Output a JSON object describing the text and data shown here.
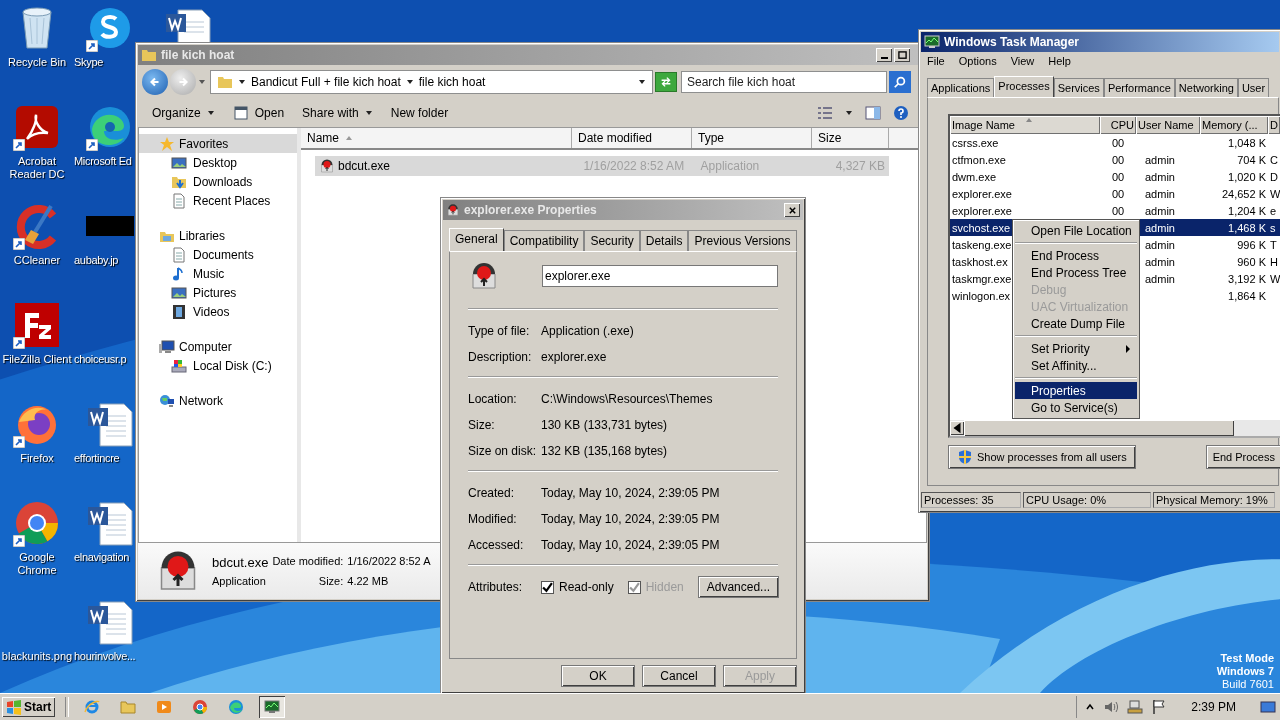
{
  "desktop_icons": [
    {
      "label": "Recycle Bin",
      "kind": "recycle",
      "shortcut": false
    },
    {
      "label": "Skype",
      "kind": "skype",
      "shortcut": true
    },
    {
      "label": "Acrobat Reader DC",
      "kind": "acrobat",
      "shortcut": true
    },
    {
      "label": "Microsoft Ed",
      "kind": "edge",
      "shortcut": true
    },
    {
      "label": "CCleaner",
      "kind": "ccleaner",
      "shortcut": true
    },
    {
      "label": "aubaby.jp",
      "kind": "black-image",
      "shortcut": false
    },
    {
      "label": "FileZilla Client",
      "kind": "filezilla",
      "shortcut": true
    },
    {
      "label": "choiceusr.p",
      "kind": "blank",
      "shortcut": false
    },
    {
      "label": "Firefox",
      "kind": "firefox",
      "shortcut": true
    },
    {
      "label": "effortincre",
      "kind": "word",
      "shortcut": false
    },
    {
      "label": "Google Chrome",
      "kind": "chrome",
      "shortcut": true
    },
    {
      "label": "elnavigation",
      "kind": "word",
      "shortcut": false
    },
    {
      "label": "blackunits.png",
      "kind": "blank",
      "shortcut": false
    },
    {
      "label": "hourinvolve...",
      "kind": "word",
      "shortcut": false
    }
  ],
  "explorer": {
    "title": "file kich hoat",
    "breadcrumb": [
      "Bandicut Full + file kich hoat",
      "file kich hoat"
    ],
    "search": {
      "placeholder": "Search file kich hoat"
    },
    "toolbar": [
      {
        "label": "Organize",
        "kind": "menu"
      },
      {
        "label": "Open",
        "kind": "open"
      },
      {
        "label": "Share with",
        "kind": "menu"
      },
      {
        "label": "New folder",
        "kind": "plain"
      }
    ],
    "nav": [
      {
        "label": "Favorites",
        "kind": "star",
        "selected": true,
        "children": [
          {
            "label": "Desktop",
            "kind": "desktop"
          },
          {
            "label": "Downloads",
            "kind": "downloads"
          },
          {
            "label": "Recent Places",
            "kind": "recent"
          }
        ]
      },
      {
        "label": "Libraries",
        "kind": "libraries",
        "selected": false,
        "children": [
          {
            "label": "Documents",
            "kind": "documents"
          },
          {
            "label": "Music",
            "kind": "music"
          },
          {
            "label": "Pictures",
            "kind": "pictures"
          },
          {
            "label": "Videos",
            "kind": "videos"
          }
        ]
      },
      {
        "label": "Computer",
        "kind": "computer",
        "selected": false,
        "children": [
          {
            "label": "Local Disk (C:)",
            "kind": "disk"
          }
        ]
      },
      {
        "label": "Network",
        "kind": "network",
        "selected": false
      }
    ],
    "columns": [
      {
        "label": "Name",
        "sorted": true
      },
      {
        "label": "Date modified",
        "sorted": false
      },
      {
        "label": "Type",
        "sorted": false
      },
      {
        "label": "Size",
        "sorted": false
      }
    ],
    "files": [
      {
        "name": "bdcut.exe",
        "date": "1/16/2022 8:52 AM",
        "type": "Application",
        "size": "4,327 KB",
        "selected": true
      }
    ],
    "details": {
      "name": "bdcut.exe",
      "type": "Application",
      "date_label": "Date modified:",
      "date": "1/16/2022 8:52 A",
      "size_label": "Size:",
      "size": "4.22 MB"
    }
  },
  "properties": {
    "title": "explorer.exe Properties",
    "tabs": [
      {
        "label": "General",
        "selected": true
      },
      {
        "label": "Compatibility",
        "selected": false
      },
      {
        "label": "Security",
        "selected": false
      },
      {
        "label": "Details",
        "selected": false
      },
      {
        "label": "Previous Versions",
        "selected": false
      }
    ],
    "name": "explorer.exe",
    "groups": [
      [
        {
          "label": "Type of file:",
          "value": "Application (.exe)"
        },
        {
          "label": "Description:",
          "value": "explorer.exe"
        }
      ],
      [
        {
          "label": "Location:",
          "value": "C:\\Windows\\Resources\\Themes"
        },
        {
          "label": "Size:",
          "value": "130 KB (133,731 bytes)"
        },
        {
          "label": "Size on disk:",
          "value": "132 KB (135,168 bytes)"
        }
      ],
      [
        {
          "label": "Created:",
          "value": "Today, May 10, 2024, 2:39:05 PM"
        },
        {
          "label": "Modified:",
          "value": "Today, May 10, 2024, 2:39:05 PM"
        },
        {
          "label": "Accessed:",
          "value": "Today, May 10, 2024, 2:39:05 PM"
        }
      ]
    ],
    "attributes_label": "Attributes:",
    "attributes": [
      {
        "label": "Read-only",
        "checked": true,
        "disabled": false
      },
      {
        "label": "Hidden",
        "checked": true,
        "disabled": true
      }
    ],
    "advanced": "Advanced...",
    "buttons": [
      {
        "label": "OK",
        "disabled": false
      },
      {
        "label": "Cancel",
        "disabled": false
      },
      {
        "label": "Apply",
        "disabled": true
      }
    ]
  },
  "task_manager": {
    "title": "Windows Task Manager",
    "menu": [
      "File",
      "Options",
      "View",
      "Help"
    ],
    "tabs": [
      {
        "label": "Applications",
        "selected": false
      },
      {
        "label": "Processes",
        "selected": true
      },
      {
        "label": "Services",
        "selected": false
      },
      {
        "label": "Performance",
        "selected": false
      },
      {
        "label": "Networking",
        "selected": false
      },
      {
        "label": "User",
        "selected": false
      }
    ],
    "columns": [
      {
        "label": "Image Name",
        "sorted": true
      },
      {
        "label": "CPU",
        "sorted": false
      },
      {
        "label": "User Name",
        "sorted": false
      },
      {
        "label": "Memory (...",
        "sorted": false
      },
      {
        "label": "D",
        "sorted": false
      }
    ],
    "rows": [
      {
        "name": "csrss.exe",
        "cpu": "00",
        "memory": "1,048 K",
        "selected": false
      },
      {
        "name": "ctfmon.exe",
        "cpu": "00",
        "user": "admin",
        "memory": "704 K",
        "column_5": "C",
        "selected": false
      },
      {
        "name": "dwm.exe",
        "cpu": "00",
        "user": "admin",
        "memory": "1,020 K",
        "column_5": "D",
        "selected": false
      },
      {
        "name": "explorer.exe",
        "cpu": "00",
        "user": "admin",
        "memory": "24,652 K",
        "column_5": "W",
        "selected": false
      },
      {
        "name": "explorer.exe",
        "cpu": "00",
        "user": "admin",
        "memory": "1,204 K",
        "column_5": "e",
        "selected": false
      },
      {
        "name": "svchost.exe",
        "user": "admin",
        "memory": "1,468 K",
        "column_5": "s",
        "selected": true
      },
      {
        "name": "taskeng.exe",
        "user": "admin",
        "memory": "996 K",
        "column_5": "T",
        "selected": false
      },
      {
        "name": "taskhost.ex",
        "user": "admin",
        "memory": "960 K",
        "column_5": "H",
        "selected": false
      },
      {
        "name": "taskmgr.exe",
        "user": "admin",
        "memory": "3,192 K",
        "column_5": "W",
        "selected": false
      },
      {
        "name": "winlogon.ex",
        "memory": "1,864 K",
        "selected": false
      }
    ],
    "show_all_button": "Show processes from all users",
    "end_process_button": "End Process",
    "status": [
      "Processes: 35",
      "CPU Usage: 0%",
      "Physical Memory: 19%"
    ]
  },
  "context_menu": [
    {
      "kind": "item",
      "label": "Open File Location",
      "disabled": false,
      "selected": false
    },
    {
      "kind": "separator"
    },
    {
      "kind": "item",
      "label": "End Process",
      "disabled": false,
      "selected": false
    },
    {
      "kind": "item",
      "label": "End Process Tree",
      "disabled": false,
      "selected": false
    },
    {
      "kind": "item",
      "label": "Debug",
      "disabled": true,
      "selected": false
    },
    {
      "kind": "item",
      "label": "UAC Virtualization",
      "disabled": true,
      "selected": false
    },
    {
      "kind": "item",
      "label": "Create Dump File",
      "disabled": false,
      "selected": false
    },
    {
      "kind": "separator"
    },
    {
      "kind": "submenu",
      "label": "Set Priority",
      "disabled": false,
      "selected": false
    },
    {
      "kind": "item",
      "label": "Set Affinity...",
      "disabled": false,
      "selected": false
    },
    {
      "kind": "separator"
    },
    {
      "kind": "item",
      "label": "Properties",
      "disabled": false,
      "selected": true
    },
    {
      "kind": "item",
      "label": "Go to Service(s)",
      "disabled": false,
      "selected": false
    }
  ],
  "test_mode": [
    "Test Mode",
    "Windows 7",
    "Build 7601"
  ],
  "taskbar": {
    "start": "Start",
    "apps": [
      {
        "kind": "ie",
        "selected": false
      },
      {
        "kind": "folder",
        "selected": false
      },
      {
        "kind": "media",
        "selected": false
      },
      {
        "kind": "chrome",
        "selected": false
      },
      {
        "kind": "edge",
        "selected": false
      },
      {
        "kind": "taskmgr",
        "selected": true
      }
    ],
    "time": "2:39 PM"
  }
}
